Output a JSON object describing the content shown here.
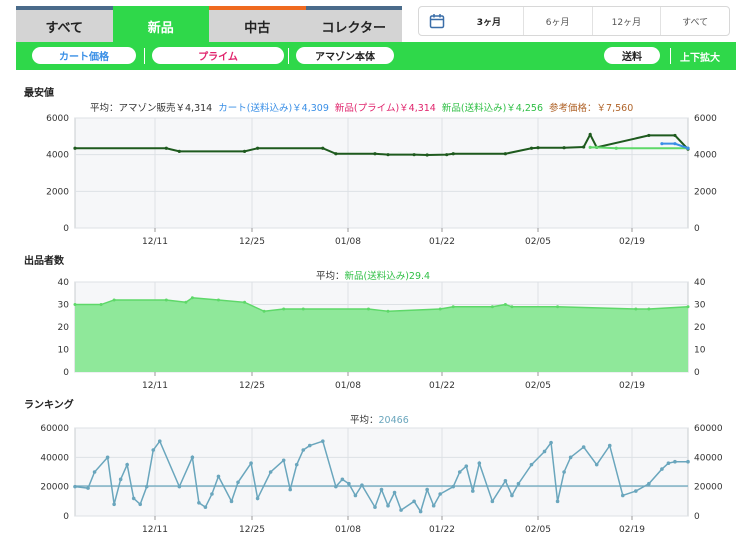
{
  "tabs": [
    {
      "label": "すべて",
      "active": false
    },
    {
      "label": "新品",
      "active": true
    },
    {
      "label": "中古",
      "active": false
    },
    {
      "label": "コレクター",
      "active": false
    }
  ],
  "range": {
    "icon": "calendar-icon",
    "options": [
      "3ヶ月",
      "6ヶ月",
      "12ヶ月",
      "すべて"
    ],
    "selected": "3ヶ月"
  },
  "filters": {
    "cart": "カート価格",
    "prime": "プライム",
    "amazon": "アマゾン本体",
    "shipping": "送料",
    "zoom": "上下拡大"
  },
  "colors": {
    "green": "#2fd84a",
    "dark_green": "#1e5a1e",
    "cart_blue": "#3a8fe6",
    "prime_pink": "#e0246c",
    "ref_brown": "#b0642a",
    "rank_blue": "#6aa6bd",
    "seller_green": "#5ed869"
  },
  "price_section": {
    "title": "最安値",
    "avg_prefix": "平均：",
    "amazon_label": "アマゾン販売￥4,314",
    "cart_label": "カート(送料込み)￥4,309",
    "prime_label": "新品(プライム)￥4,314",
    "new_label": "新品(送料込み)￥4,256",
    "ref_label": "参考価格：￥7,560"
  },
  "sellers_section": {
    "title": "出品者数",
    "avg_prefix": "平均：",
    "avg_label": "新品(送料込み)29.4"
  },
  "rank_section": {
    "title": "ランキング",
    "avg_prefix": "平均：",
    "avg_value": "20466"
  },
  "chart_data": [
    {
      "type": "line",
      "title": "最安値",
      "x_ticks": [
        "12/11",
        "12/25",
        "01/08",
        "01/22",
        "02/05",
        "02/19"
      ],
      "ylim": [
        0,
        6000
      ],
      "y_ticks": [
        0,
        2000,
        4000,
        6000
      ],
      "grid": true,
      "series": [
        {
          "name": "新品(送料込み)",
          "color": "#1e5a1e",
          "x": [
            0,
            14,
            16,
            26,
            28,
            38,
            40,
            46,
            48,
            52,
            54,
            57,
            58,
            66,
            70,
            71,
            75,
            78,
            79,
            80,
            88,
            92,
            94
          ],
          "y": [
            4350,
            4350,
            4180,
            4180,
            4350,
            4350,
            4050,
            4050,
            4000,
            4000,
            3980,
            4000,
            4050,
            4050,
            4350,
            4380,
            4380,
            4420,
            5100,
            4400,
            5050,
            5050,
            4300
          ]
        },
        {
          "name": "新品(プライム)",
          "color": "#5ed869",
          "x": [
            79,
            80,
            83,
            94
          ],
          "y": [
            4400,
            4400,
            4350,
            4350
          ]
        },
        {
          "name": "カート(送料込み)",
          "color": "#3a8fe6",
          "x": [
            90,
            92,
            94
          ],
          "y": [
            4600,
            4600,
            4350
          ]
        }
      ]
    },
    {
      "type": "area",
      "title": "出品者数",
      "x_ticks": [
        "12/11",
        "12/25",
        "01/08",
        "01/22",
        "02/05",
        "02/19"
      ],
      "ylim": [
        0,
        40
      ],
      "y_ticks": [
        0,
        10,
        20,
        30,
        40
      ],
      "grid": true,
      "series": [
        {
          "name": "新品(送料込み)",
          "color": "#5ed869",
          "x": [
            0,
            4,
            6,
            14,
            17,
            18,
            22,
            26,
            29,
            32,
            35,
            45,
            48,
            56,
            58,
            64,
            66,
            67,
            74,
            86,
            88,
            94
          ],
          "y": [
            30,
            30,
            32,
            32,
            31,
            33,
            32,
            31,
            27,
            28,
            28,
            28,
            27,
            28,
            29,
            29,
            30,
            29,
            29,
            28,
            28,
            29
          ]
        }
      ]
    },
    {
      "type": "line",
      "title": "ランキング",
      "x_ticks": [
        "12/11",
        "12/25",
        "01/08",
        "01/22",
        "02/05",
        "02/19"
      ],
      "ylim": [
        0,
        60000
      ],
      "y_ticks": [
        0,
        20000,
        40000,
        60000
      ],
      "grid": true,
      "average": 20466,
      "series": [
        {
          "name": "ランキング",
          "color": "#6aa6bd",
          "x": [
            0,
            2,
            3,
            5,
            6,
            7,
            8,
            9,
            10,
            11,
            12,
            13,
            16,
            18,
            19,
            20,
            21,
            22,
            24,
            25,
            27,
            28,
            30,
            32,
            33,
            34,
            35,
            36,
            38,
            40,
            41,
            42,
            43,
            44,
            46,
            47,
            48,
            49,
            50,
            52,
            53,
            54,
            55,
            56,
            58,
            59,
            60,
            61,
            62,
            64,
            66,
            67,
            68,
            70,
            72,
            73,
            74,
            75,
            76,
            78,
            80,
            82,
            84,
            86,
            88,
            90,
            91,
            92,
            94
          ],
          "y": [
            20000,
            19000,
            30000,
            40000,
            8000,
            25000,
            35000,
            12000,
            8000,
            20000,
            45000,
            51000,
            20000,
            40000,
            9000,
            6000,
            15000,
            27000,
            10000,
            23000,
            36000,
            12000,
            30000,
            38000,
            18000,
            35000,
            45000,
            48000,
            51000,
            20000,
            25000,
            22000,
            14000,
            21000,
            6000,
            18000,
            7000,
            16000,
            4000,
            10000,
            3000,
            18000,
            7000,
            15000,
            20000,
            30000,
            34000,
            17000,
            36000,
            10000,
            24000,
            14000,
            22000,
            35000,
            44000,
            50000,
            10000,
            30000,
            40000,
            47000,
            35000,
            48000,
            14000,
            17000,
            22000,
            32000,
            36000,
            37000,
            37000
          ]
        }
      ]
    }
  ]
}
